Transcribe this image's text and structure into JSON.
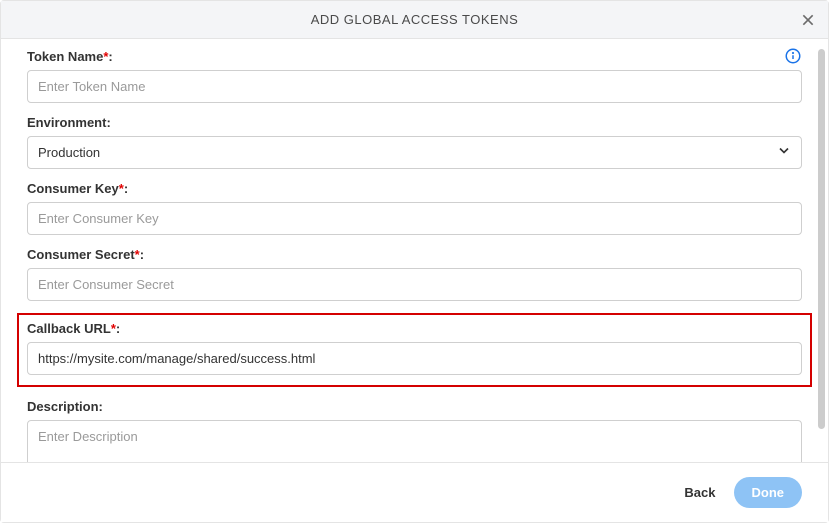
{
  "header": {
    "title": "ADD GLOBAL ACCESS TOKENS"
  },
  "fields": {
    "tokenName": {
      "label": "Token Name",
      "placeholder": "Enter Token Name",
      "value": ""
    },
    "environment": {
      "label": "Environment",
      "selected": "Production"
    },
    "consumerKey": {
      "label": "Consumer Key",
      "placeholder": "Enter Consumer Key",
      "value": ""
    },
    "consumerSecret": {
      "label": "Consumer Secret",
      "placeholder": "Enter Consumer Secret",
      "value": ""
    },
    "callbackUrl": {
      "label": "Callback URL",
      "value": "https://mysite.com/manage/shared/success.html"
    },
    "description": {
      "label": "Description",
      "placeholder": "Enter Description",
      "value": ""
    }
  },
  "footer": {
    "back": "Back",
    "done": "Done"
  },
  "punct": {
    "star": "*",
    "colon": ":"
  }
}
